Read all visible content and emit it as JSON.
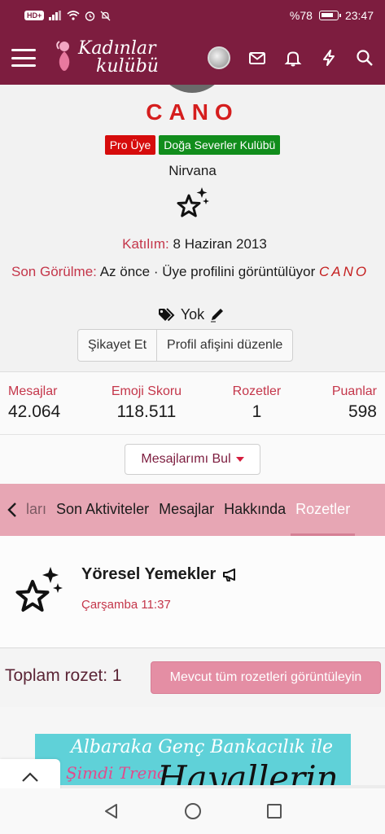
{
  "status_bar": {
    "hd_badge": "HD+",
    "battery_percent": "%78",
    "time": "23:47"
  },
  "header": {
    "logo_line1": "Kadınlar",
    "logo_line2": "kulübü",
    "icons": [
      "menu-icon",
      "avatar",
      "mail-icon",
      "bell-icon",
      "bolt-icon",
      "search-icon"
    ]
  },
  "profile": {
    "username": "CANO",
    "badge_pro": "Pro Üye",
    "badge_club": "Doğa Severler Kulübü",
    "custom_title": "Nirvana",
    "joined_label": "Katılım:",
    "joined_value": "8 Haziran 2013",
    "last_seen_label": "Son Görülme:",
    "last_seen_text": "Az önce · Üye profilini görüntülüyor",
    "last_seen_user": "CANO",
    "location_value": "Yok",
    "report_button": "Şikayet Et",
    "edit_banner_button": "Profil afişini düzenle"
  },
  "stats": [
    {
      "label": "Mesajlar",
      "value": "42.064"
    },
    {
      "label": "Emoji Skoru",
      "value": "118.511"
    },
    {
      "label": "Rozetler",
      "value": "1"
    },
    {
      "label": "Puanlar",
      "value": "598"
    }
  ],
  "find_button": "Mesajlarımı Bul",
  "tabs": {
    "partial": "ları",
    "items": [
      "Son Aktiviteler",
      "Mesajlar",
      "Hakkında",
      "Rozetler"
    ],
    "active": "Rozetler"
  },
  "trophy": {
    "title": "Yöresel Yemekler",
    "date": "Çarşamba 11:37"
  },
  "footer": {
    "total": "Toplam rozet: 1",
    "view_all_button": "Mevcut tüm rozetleri görüntüleyin"
  },
  "ad": {
    "line1": "Albaraka Genç Bankacılık ile",
    "line2": "Şimdi Trend",
    "line3": "Hayallerin"
  },
  "colors": {
    "brand": "#7d1d3f",
    "tab_bar": "#e7a6b4",
    "label_red": "#c4364a",
    "username_red": "#d51e1e"
  }
}
